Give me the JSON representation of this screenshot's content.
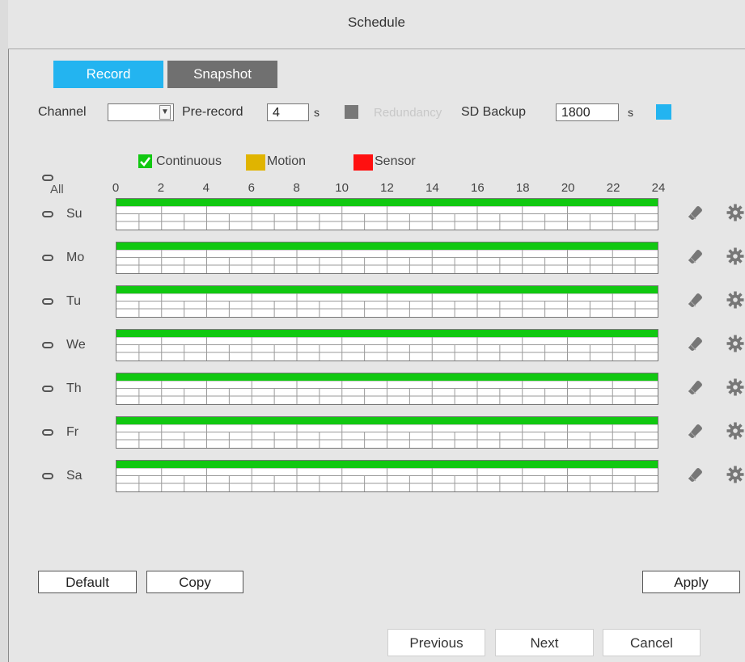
{
  "window": {
    "title": "Schedule"
  },
  "tabs": [
    {
      "label": "Record",
      "active": true
    },
    {
      "label": "Snapshot",
      "active": false
    }
  ],
  "settings": {
    "channel_label": "Channel",
    "channel_value": "",
    "prerecord_label": "Pre-record",
    "prerecord_value": "4",
    "prerecord_unit": "s",
    "redundancy_label": "Redundancy",
    "sdbackup_label": "SD Backup",
    "sdbackup_value": "1800",
    "sdbackup_unit": "s"
  },
  "legend": [
    {
      "label": "Continuous",
      "color": "#11c811",
      "checked": true
    },
    {
      "label": "Motion",
      "color": "#e0b400",
      "checked": false
    },
    {
      "label": "Sensor",
      "color": "#ff1010",
      "checked": false
    }
  ],
  "all_label": "All",
  "hours": [
    "0",
    "2",
    "4",
    "6",
    "8",
    "10",
    "12",
    "14",
    "16",
    "18",
    "20",
    "22",
    "24"
  ],
  "days": [
    {
      "label": "Su",
      "continuous": [
        0,
        24
      ]
    },
    {
      "label": "Mo",
      "continuous": [
        0,
        24
      ]
    },
    {
      "label": "Tu",
      "continuous": [
        0,
        24
      ]
    },
    {
      "label": "We",
      "continuous": [
        0,
        24
      ]
    },
    {
      "label": "Th",
      "continuous": [
        0,
        24
      ]
    },
    {
      "label": "Fr",
      "continuous": [
        0,
        24
      ]
    },
    {
      "label": "Sa",
      "continuous": [
        0,
        24
      ]
    }
  ],
  "buttons": {
    "default": "Default",
    "copy": "Copy",
    "apply": "Apply",
    "previous": "Previous",
    "next": "Next",
    "cancel": "Cancel"
  },
  "colors": {
    "accent": "#23b4f0",
    "inactive_tab": "#707070",
    "continuous": "#11c811"
  }
}
